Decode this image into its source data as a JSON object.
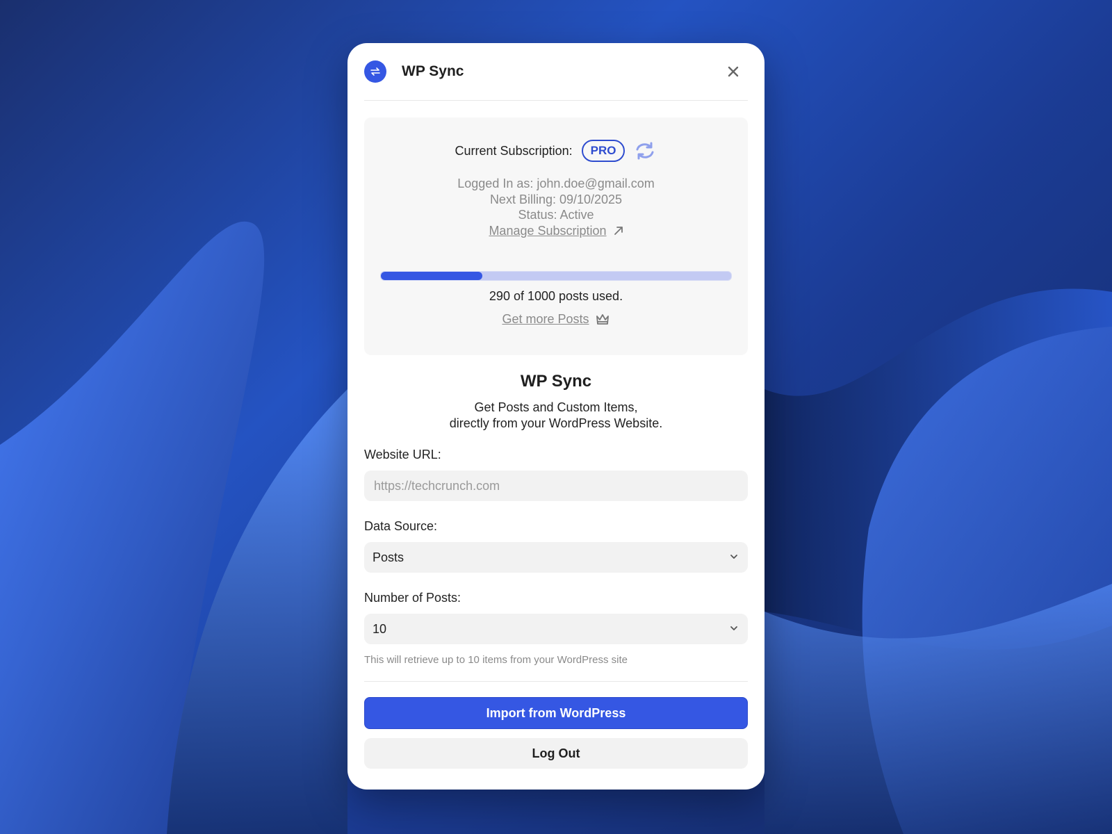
{
  "app": {
    "title": "WP Sync",
    "logo_icon": "sync-arrows-icon",
    "accent_color": "#3557e3"
  },
  "subscription": {
    "label": "Current Subscription:",
    "plan": "PRO",
    "logged_in": "Logged In as: john.doe@gmail.com",
    "next_billing": "Next Billing: 09/10/2025",
    "status": "Status: Active",
    "manage_link": "Manage Subscription"
  },
  "usage": {
    "used": 290,
    "total": 1000,
    "text": "290 of 1000 posts used.",
    "more_link": "Get more Posts"
  },
  "intro": {
    "title": "WP Sync",
    "line1": "Get Posts and Custom Items,",
    "line2": "directly from your WordPress Website."
  },
  "form": {
    "website_label": "Website URL:",
    "website_placeholder": "https://techcrunch.com",
    "website_value": "",
    "source_label": "Data Source:",
    "source_value": "Posts",
    "count_label": "Number of Posts:",
    "count_value": "10",
    "hint": "This will retrieve up to 10 items from your WordPress site"
  },
  "actions": {
    "import": "Import from WordPress",
    "logout": "Log Out"
  }
}
